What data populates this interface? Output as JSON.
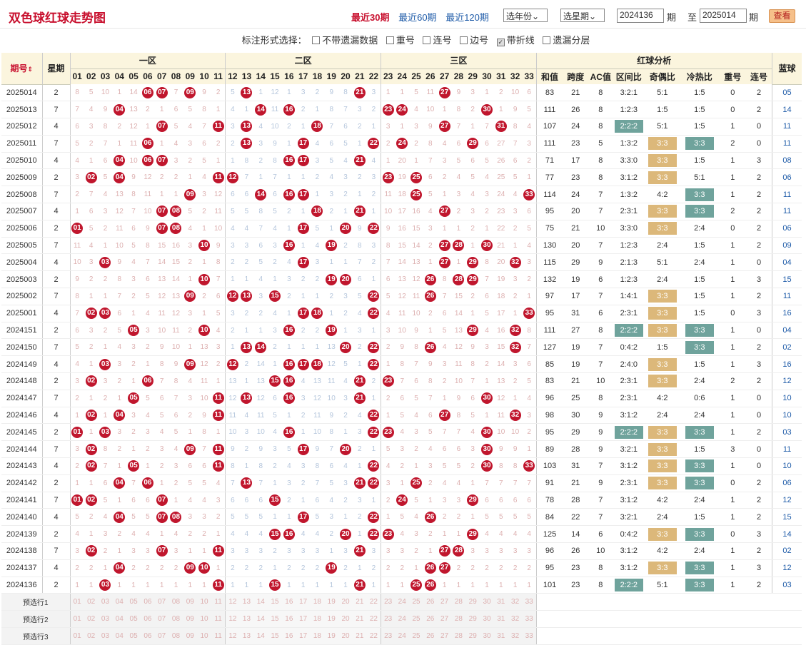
{
  "title": "双色球红球走势图",
  "nav": [
    "最近30期",
    "最近60期",
    "最近120期"
  ],
  "year_select": "选年份",
  "week_select": "选星期",
  "from_issue": "2024136",
  "to_issue": "2025014",
  "issue_suffix": "期",
  "to_label": "至",
  "query_button": "查看",
  "options": {
    "label": "标注形式选择：",
    "items": [
      {
        "text": "不带遗漏数据",
        "checked": false
      },
      {
        "text": "重号",
        "checked": false
      },
      {
        "text": "连号",
        "checked": false
      },
      {
        "text": "边号",
        "checked": false
      },
      {
        "text": "带折线",
        "checked": true
      },
      {
        "text": "遗漏分层",
        "checked": false
      }
    ]
  },
  "headers": {
    "issue": "期号",
    "weekday": "星期",
    "zones": [
      "一区",
      "二区",
      "三区"
    ],
    "analysis": "红球分析",
    "blue": "蓝球",
    "cols": [
      "和值",
      "跨度",
      "AC值",
      "区间比",
      "奇偶比",
      "冷热比",
      "重号",
      "连号"
    ]
  },
  "rows": [
    {
      "issue": "2025014",
      "wk": "2",
      "balls": [
        6,
        7,
        9,
        13,
        21,
        27
      ],
      "sum": "83",
      "span": "21",
      "ac": "8",
      "zone": "3:2:1",
      "oe": "5:1",
      "ch": "1:5",
      "rep": "0",
      "con": "2",
      "blue": "05"
    },
    {
      "issue": "2025013",
      "wk": "7",
      "balls": [
        4,
        14,
        16,
        23,
        24,
        30
      ],
      "sum": "111",
      "span": "26",
      "ac": "8",
      "zone": "1:2:3",
      "oe": "1:5",
      "ch": "1:5",
      "rep": "0",
      "con": "2",
      "blue": "14"
    },
    {
      "issue": "2025012",
      "wk": "4",
      "balls": [
        7,
        11,
        13,
        18,
        27,
        31
      ],
      "sum": "107",
      "span": "24",
      "ac": "8",
      "zone": "2:2:2",
      "oe": "5:1",
      "ch": "1:5",
      "rep": "1",
      "con": "0",
      "blue": "11"
    },
    {
      "issue": "2025011",
      "wk": "7",
      "balls": [
        6,
        13,
        17,
        22,
        24,
        29
      ],
      "sum": "111",
      "span": "23",
      "ac": "5",
      "zone": "1:3:2",
      "oe": "3:3",
      "ch": "3:3",
      "rep": "2",
      "con": "0",
      "blue": "11"
    },
    {
      "issue": "2025010",
      "wk": "4",
      "balls": [
        4,
        6,
        7,
        16,
        17,
        21
      ],
      "sum": "71",
      "span": "17",
      "ac": "8",
      "zone": "3:3:0",
      "oe": "3:3",
      "ch": "1:5",
      "rep": "1",
      "con": "3",
      "blue": "08"
    },
    {
      "issue": "2025009",
      "wk": "2",
      "balls": [
        2,
        4,
        11,
        12,
        23,
        25
      ],
      "sum": "77",
      "span": "23",
      "ac": "8",
      "zone": "3:1:2",
      "oe": "3:3",
      "ch": "5:1",
      "rep": "1",
      "con": "2",
      "blue": "06"
    },
    {
      "issue": "2025008",
      "wk": "7",
      "balls": [
        9,
        14,
        16,
        17,
        25,
        33
      ],
      "sum": "114",
      "span": "24",
      "ac": "7",
      "zone": "1:3:2",
      "oe": "4:2",
      "ch": "3:3",
      "rep": "1",
      "con": "2",
      "blue": "11"
    },
    {
      "issue": "2025007",
      "wk": "4",
      "balls": [
        7,
        8,
        18,
        21,
        27
      ],
      "sum": "95",
      "span": "20",
      "ac": "7",
      "zone": "2:3:1",
      "oe": "3:3",
      "ch": "3:3",
      "rep": "2",
      "con": "2",
      "blue": "11"
    },
    {
      "issue": "2025006",
      "wk": "2",
      "balls": [
        1,
        7,
        8,
        17,
        20,
        22
      ],
      "sum": "75",
      "span": "21",
      "ac": "10",
      "zone": "3:3:0",
      "oe": "3:3",
      "ch": "2:4",
      "rep": "0",
      "con": "2",
      "blue": "06"
    },
    {
      "issue": "2025005",
      "wk": "7",
      "balls": [
        10,
        16,
        19,
        27,
        28,
        30
      ],
      "sum": "130",
      "span": "20",
      "ac": "7",
      "zone": "1:2:3",
      "oe": "2:4",
      "ch": "1:5",
      "rep": "1",
      "con": "2",
      "blue": "09"
    },
    {
      "issue": "2025004",
      "wk": "4",
      "balls": [
        3,
        17,
        27,
        29,
        32
      ],
      "sum": "115",
      "span": "29",
      "ac": "9",
      "zone": "2:1:3",
      "oe": "5:1",
      "ch": "2:4",
      "rep": "1",
      "con": "0",
      "blue": "04"
    },
    {
      "issue": "2025003",
      "wk": "2",
      "balls": [
        10,
        19,
        20,
        26,
        28,
        29
      ],
      "sum": "132",
      "span": "19",
      "ac": "6",
      "zone": "1:2:3",
      "oe": "2:4",
      "ch": "1:5",
      "rep": "1",
      "con": "3",
      "blue": "15"
    },
    {
      "issue": "2025002",
      "wk": "7",
      "balls": [
        9,
        12,
        13,
        15,
        22,
        26
      ],
      "sum": "97",
      "span": "17",
      "ac": "7",
      "zone": "1:4:1",
      "oe": "3:3",
      "ch": "1:5",
      "rep": "1",
      "con": "2",
      "blue": "11"
    },
    {
      "issue": "2025001",
      "wk": "4",
      "balls": [
        2,
        3,
        17,
        18,
        22,
        33
      ],
      "sum": "95",
      "span": "31",
      "ac": "6",
      "zone": "2:3:1",
      "oe": "3:3",
      "ch": "1:5",
      "rep": "0",
      "con": "3",
      "blue": "16"
    },
    {
      "issue": "2024151",
      "wk": "2",
      "balls": [
        5,
        10,
        16,
        19,
        29,
        32
      ],
      "sum": "111",
      "span": "27",
      "ac": "8",
      "zone": "2:2:2",
      "oe": "3:3",
      "ch": "3:3",
      "rep": "1",
      "con": "0",
      "blue": "04"
    },
    {
      "issue": "2024150",
      "wk": "7",
      "balls": [
        13,
        14,
        20,
        22,
        26,
        32
      ],
      "sum": "127",
      "span": "19",
      "ac": "7",
      "zone": "0:4:2",
      "oe": "1:5",
      "ch": "3:3",
      "rep": "1",
      "con": "2",
      "blue": "02"
    },
    {
      "issue": "2024149",
      "wk": "4",
      "balls": [
        3,
        9,
        12,
        16,
        17,
        18,
        22
      ],
      "sum": "85",
      "span": "19",
      "ac": "7",
      "zone": "2:4:0",
      "oe": "3:3",
      "ch": "1:5",
      "rep": "1",
      "con": "3",
      "blue": "16"
    },
    {
      "issue": "2024148",
      "wk": "2",
      "balls": [
        2,
        6,
        15,
        16,
        21,
        23
      ],
      "sum": "83",
      "span": "21",
      "ac": "10",
      "zone": "2:3:1",
      "oe": "3:3",
      "ch": "2:4",
      "rep": "2",
      "con": "2",
      "blue": "12"
    },
    {
      "issue": "2024147",
      "wk": "7",
      "balls": [
        5,
        11,
        13,
        16,
        21,
        30
      ],
      "sum": "96",
      "span": "25",
      "ac": "8",
      "zone": "2:3:1",
      "oe": "4:2",
      "ch": "0:6",
      "rep": "1",
      "con": "0",
      "blue": "10"
    },
    {
      "issue": "2024146",
      "wk": "4",
      "balls": [
        2,
        4,
        11,
        22,
        27,
        32
      ],
      "sum": "98",
      "span": "30",
      "ac": "9",
      "zone": "3:1:2",
      "oe": "2:4",
      "ch": "2:4",
      "rep": "1",
      "con": "0",
      "blue": "10"
    },
    {
      "issue": "2024145",
      "wk": "2",
      "balls": [
        1,
        3,
        16,
        22,
        23,
        30
      ],
      "sum": "95",
      "span": "29",
      "ac": "9",
      "zone": "2:2:2",
      "oe": "3:3",
      "ch": "3:3",
      "rep": "1",
      "con": "2",
      "blue": "03"
    },
    {
      "issue": "2024144",
      "wk": "7",
      "balls": [
        2,
        9,
        11,
        17,
        20,
        30
      ],
      "sum": "89",
      "span": "28",
      "ac": "9",
      "zone": "3:2:1",
      "oe": "3:3",
      "ch": "1:5",
      "rep": "3",
      "con": "0",
      "blue": "11"
    },
    {
      "issue": "2024143",
      "wk": "4",
      "balls": [
        2,
        5,
        11,
        22,
        30,
        33
      ],
      "sum": "103",
      "span": "31",
      "ac": "7",
      "zone": "3:1:2",
      "oe": "3:3",
      "ch": "3:3",
      "rep": "1",
      "con": "0",
      "blue": "10"
    },
    {
      "issue": "2024142",
      "wk": "2",
      "balls": [
        4,
        6,
        13,
        21,
        22,
        25
      ],
      "sum": "91",
      "span": "21",
      "ac": "9",
      "zone": "2:3:1",
      "oe": "3:3",
      "ch": "3:3",
      "rep": "0",
      "con": "2",
      "blue": "06"
    },
    {
      "issue": "2024141",
      "wk": "7",
      "balls": [
        1,
        2,
        7,
        15,
        24,
        29
      ],
      "sum": "78",
      "span": "28",
      "ac": "7",
      "zone": "3:1:2",
      "oe": "4:2",
      "ch": "2:4",
      "rep": "1",
      "con": "2",
      "blue": "12"
    },
    {
      "issue": "2024140",
      "wk": "4",
      "balls": [
        4,
        7,
        8,
        17,
        22,
        26
      ],
      "sum": "84",
      "span": "22",
      "ac": "7",
      "zone": "3:2:1",
      "oe": "2:4",
      "ch": "1:5",
      "rep": "1",
      "con": "2",
      "blue": "15"
    },
    {
      "issue": "2024139",
      "wk": "2",
      "balls": [
        15,
        16,
        20,
        22,
        23,
        29
      ],
      "sum": "125",
      "span": "14",
      "ac": "6",
      "zone": "0:4:2",
      "oe": "3:3",
      "ch": "3:3",
      "rep": "0",
      "con": "3",
      "blue": "14"
    },
    {
      "issue": "2024138",
      "wk": "7",
      "balls": [
        2,
        7,
        11,
        21,
        27,
        28
      ],
      "sum": "96",
      "span": "26",
      "ac": "10",
      "zone": "3:1:2",
      "oe": "4:2",
      "ch": "2:4",
      "rep": "1",
      "con": "2",
      "blue": "02"
    },
    {
      "issue": "2024137",
      "wk": "4",
      "balls": [
        4,
        9,
        10,
        19,
        26,
        27
      ],
      "sum": "95",
      "span": "23",
      "ac": "8",
      "zone": "3:1:2",
      "oe": "3:3",
      "ch": "3:3",
      "rep": "1",
      "con": "3",
      "blue": "12"
    },
    {
      "issue": "2024136",
      "wk": "2",
      "balls": [
        3,
        11,
        15,
        21,
        25,
        26
      ],
      "sum": "101",
      "span": "23",
      "ac": "8",
      "zone": "2:2:2",
      "oe": "5:1",
      "ch": "3:3",
      "rep": "1",
      "con": "2",
      "blue": "03"
    }
  ],
  "preselect": [
    "预选行1",
    "预选行2",
    "预选行3"
  ]
}
